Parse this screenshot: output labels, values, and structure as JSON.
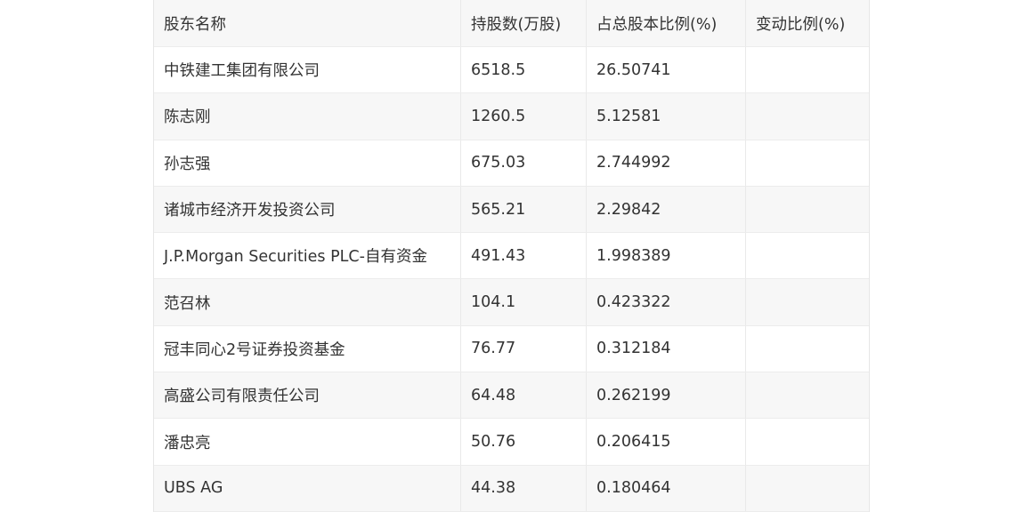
{
  "table": {
    "headers": [
      "股东名称",
      "持股数(万股)",
      "占总股本比例(%)",
      "变动比例(%)"
    ],
    "rows": [
      [
        "中铁建工集团有限公司",
        "6518.5",
        "26.50741",
        ""
      ],
      [
        "陈志刚",
        "1260.5",
        "5.12581",
        ""
      ],
      [
        "孙志强",
        "675.03",
        "2.744992",
        ""
      ],
      [
        "诸城市经济开发投资公司",
        "565.21",
        "2.29842",
        ""
      ],
      [
        "J.P.Morgan Securities PLC-自有资金",
        "491.43",
        "1.998389",
        ""
      ],
      [
        "范召林",
        "104.1",
        "0.423322",
        ""
      ],
      [
        "冠丰同心2号证券投资基金",
        "76.77",
        "0.312184",
        ""
      ],
      [
        "高盛公司有限责任公司",
        "64.48",
        "0.262199",
        ""
      ],
      [
        "潘忠亮",
        "50.76",
        "0.206415",
        ""
      ],
      [
        "UBS AG",
        "44.38",
        "0.180464",
        ""
      ]
    ]
  }
}
